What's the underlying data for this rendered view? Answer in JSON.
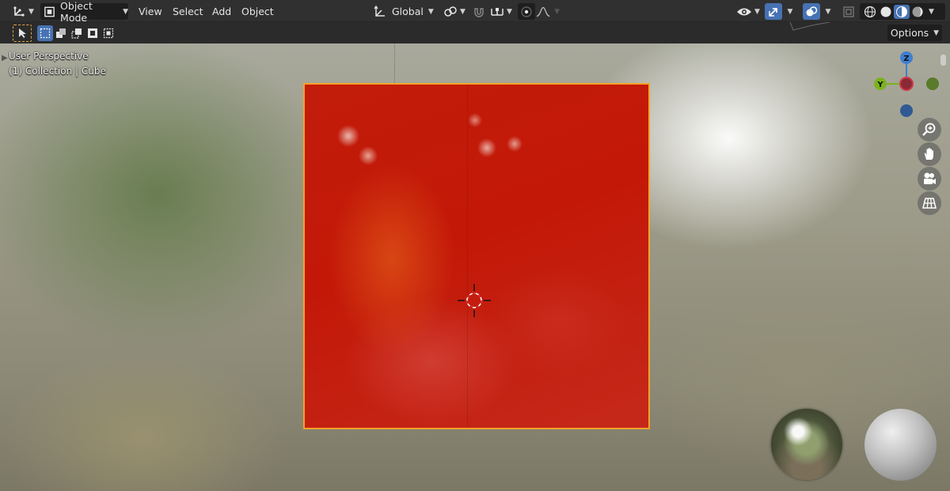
{
  "header": {
    "editor_type_icon": "axis-gizmo-icon",
    "mode_label": "Object Mode",
    "menus": [
      "View",
      "Select",
      "Add",
      "Object"
    ],
    "transform_orientation": "Global",
    "icons": {
      "orientation": "transform-orientation-icon",
      "pivot": "pivot-point-icon",
      "snap": "snap-magnet-icon",
      "snap_target": "snap-target-icon",
      "proportional": "proportional-edit-icon",
      "falloff": "falloff-curve-icon",
      "visibility": "eye-visibility-icon",
      "gizmo": "gizmo-arrow-icon",
      "overlays": "overlays-icon",
      "xray": "xray-toggle-icon",
      "shading_wire": "wireframe-shading-icon",
      "shading_solid": "solid-shading-icon",
      "shading_material": "material-shading-icon",
      "shading_rendered": "rendered-shading-icon"
    }
  },
  "toolbar": {
    "options_label": "Options",
    "select_modes": [
      "select-box-new-icon",
      "select-box-extend-icon",
      "select-box-subtract-icon",
      "select-box-invert-icon",
      "select-box-intersect-icon"
    ]
  },
  "viewport": {
    "view_name": "User Perspective",
    "collection_info": "(1) Collection | Cube",
    "gizmo_axes": [
      "Z",
      "Y"
    ],
    "nav_buttons": [
      "zoom-icon",
      "hand-pan-icon",
      "camera-icon",
      "grid-ortho-icon"
    ]
  },
  "colors": {
    "accent_blue": "#4772b3",
    "selection_orange": "#f5a12a",
    "axis_x": "#d03a4b",
    "axis_y": "#7cb21e",
    "axis_z": "#3f7fd1",
    "plane_red": "#c21c0a"
  }
}
